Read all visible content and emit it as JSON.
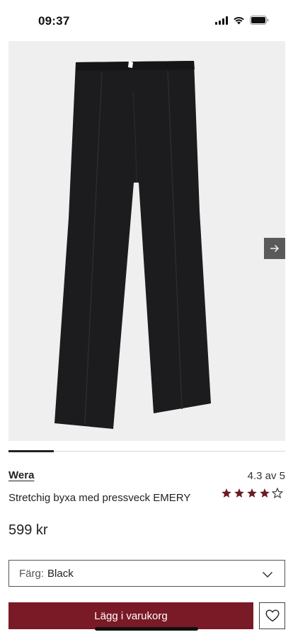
{
  "status_bar": {
    "time": "09:37",
    "icons": [
      "signal-icon",
      "wifi-icon",
      "battery-icon"
    ]
  },
  "product": {
    "image_alt": "product-image-black-trousers",
    "brand": "Wera",
    "name": "Stretchig byxa med pressveck EMERY",
    "price": "599 kr",
    "rating_text": "4.3 av 5",
    "rating_value": 4.3,
    "rating_max": 5,
    "carousel_icon": "arrow-right-icon"
  },
  "color_select": {
    "label": "Färg:",
    "value": "Black",
    "icon": "chevron-down-icon"
  },
  "actions": {
    "add_to_cart_label": "Lägg i varukorg",
    "wishlist_icon": "heart-icon"
  },
  "colors": {
    "accent": "#7a1a26",
    "star": "#6b1a24",
    "image_bg": "#efefef"
  }
}
